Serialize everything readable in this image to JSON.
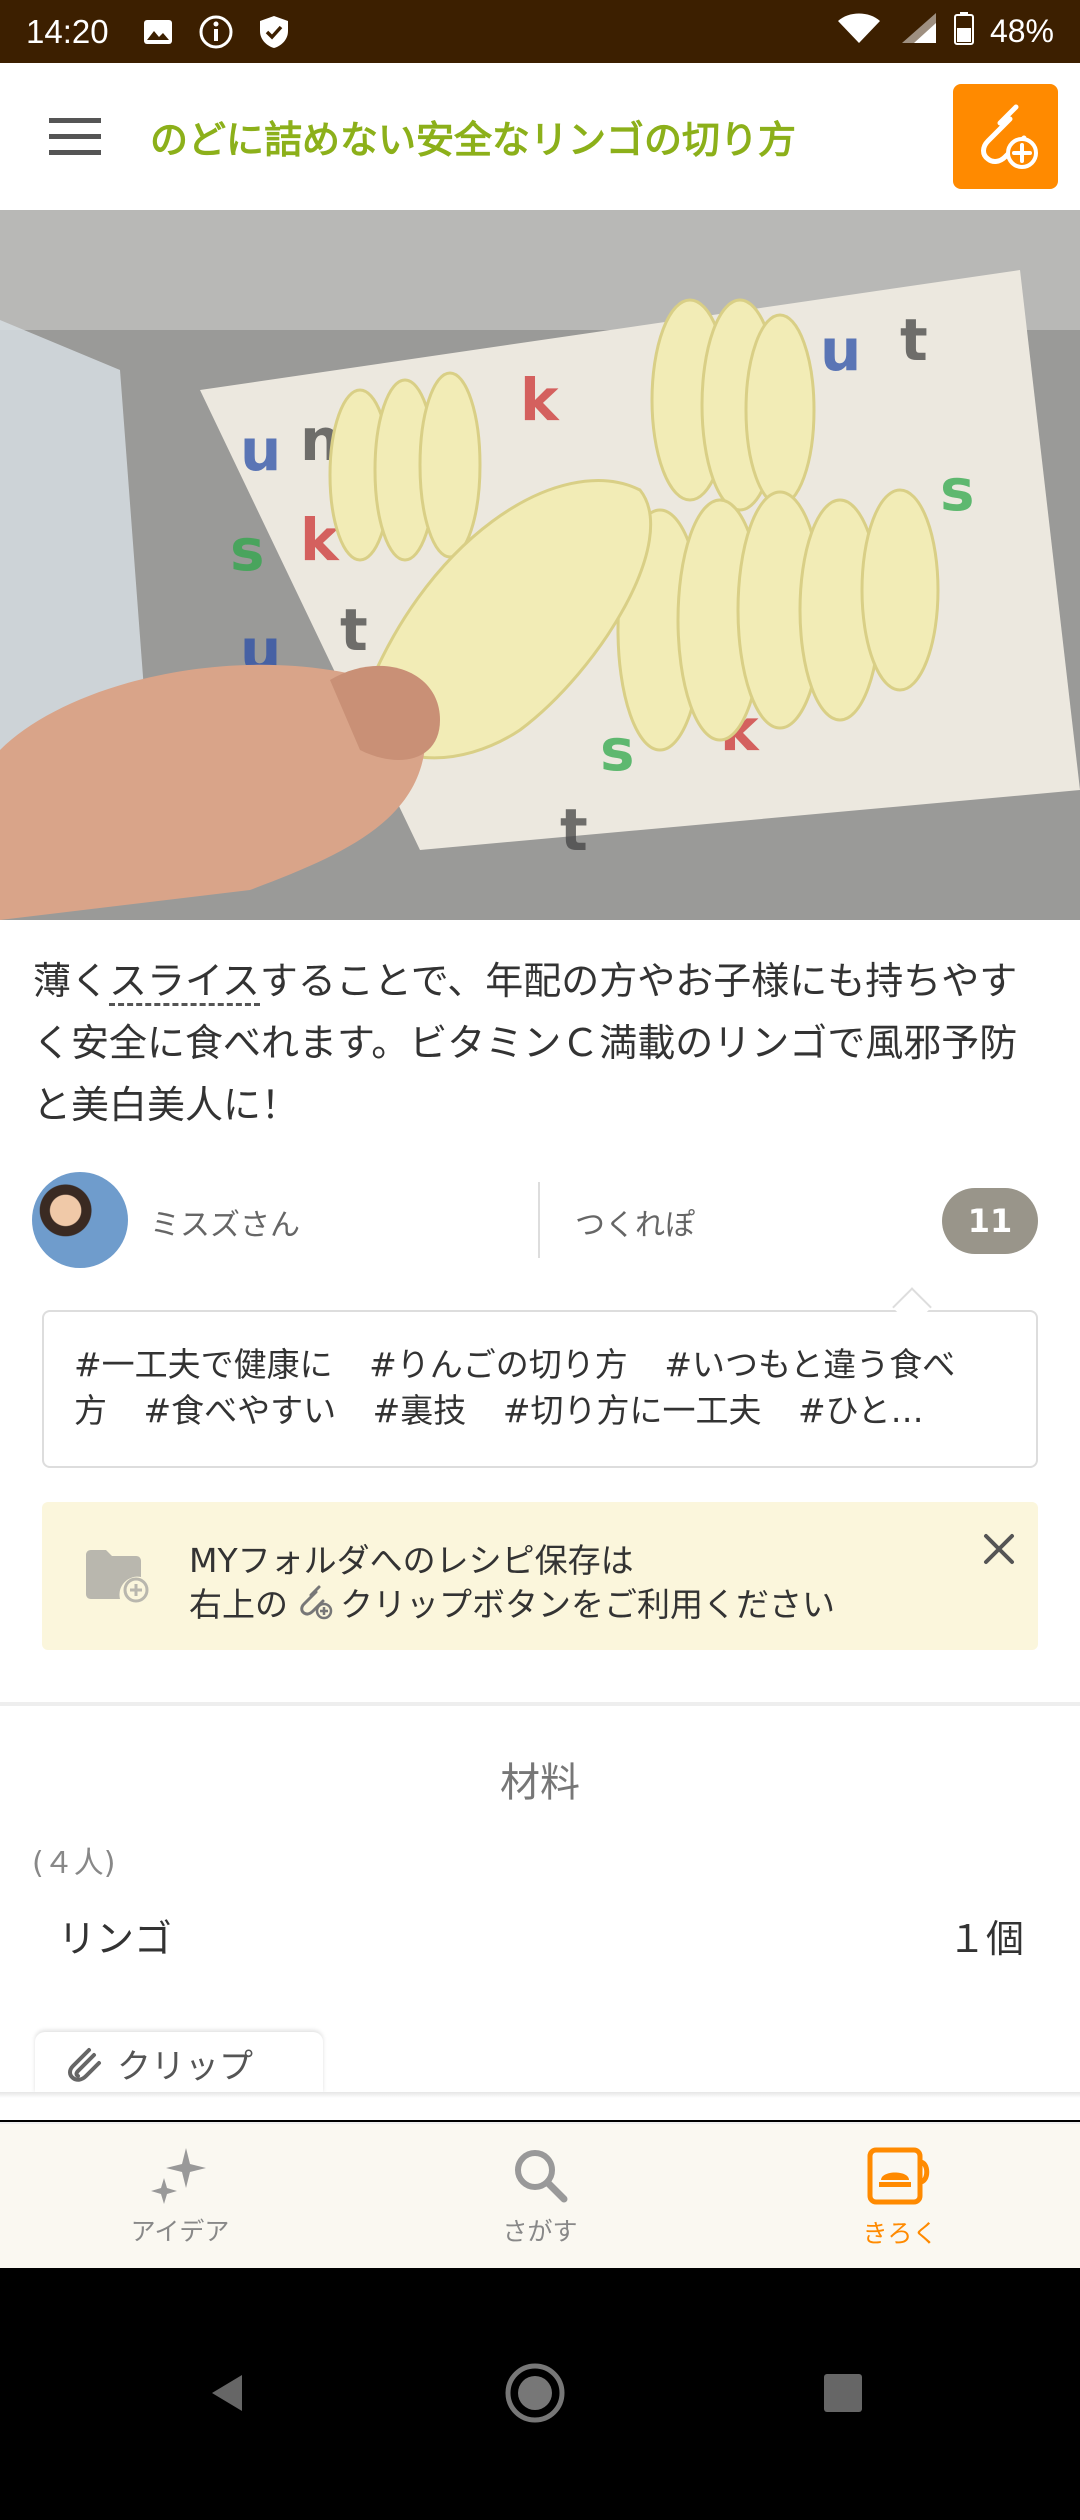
{
  "status_bar": {
    "time": "14:20",
    "battery": "48%"
  },
  "header": {
    "title": "のどに詰めない安全なリンゴの切り方"
  },
  "recipe": {
    "description_pre": "薄く",
    "description_dotted": "スライス",
    "description_post": "することで、年配の方やお子様にも持ちやすく安全に食べれます。ビタミンＣ満載のリンゴで風邪予防と美白美人に！"
  },
  "author": {
    "name": "ミスズさん",
    "tsukurepo_label": "つくれぽ",
    "tsukurepo_count": "11"
  },
  "tags": [
    "#一工夫で健康に",
    "#りんごの切り方",
    "#いつもと違う食べ方",
    "#食べやすい",
    "#裏技",
    "#切り方に一工夫",
    "#ひと…"
  ],
  "notice": {
    "line1": "MYフォルダへのレシピ保存は",
    "line2_pre": "右上の",
    "line2_post": "クリップボタンをご利用ください"
  },
  "ingredients": {
    "title": "材料",
    "servings": "(４人)",
    "items": [
      {
        "name": "リンゴ",
        "qty": "１個"
      }
    ]
  },
  "clip_tab": {
    "label": "クリップ"
  },
  "bottom_nav": [
    {
      "label": "アイデア",
      "icon": "sparkle-icon"
    },
    {
      "label": "さがす",
      "icon": "search-icon"
    },
    {
      "label": "きろく",
      "icon": "record-icon"
    }
  ],
  "colors": {
    "accent": "#ff8a00",
    "title_green": "#8cb01a",
    "status_bar": "#3c1f00"
  }
}
